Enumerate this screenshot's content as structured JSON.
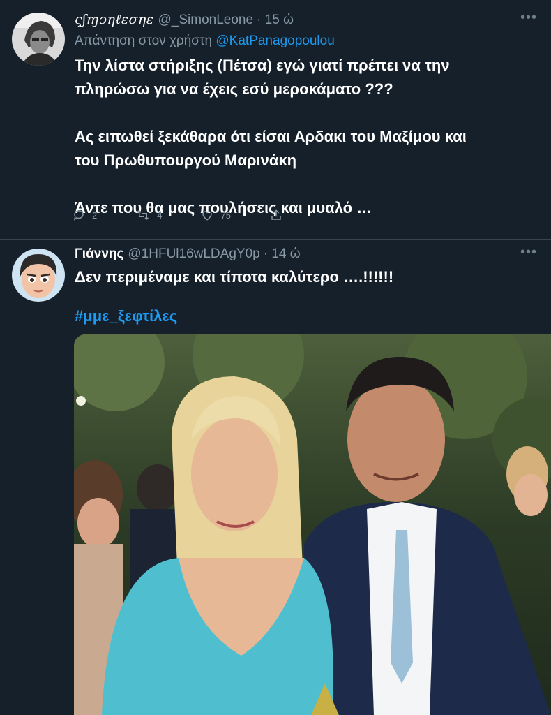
{
  "tweet1": {
    "display_name": "ςʃɱɔηℓεσηε",
    "handle": "@_SimonLeone",
    "time": "· 15 ώ",
    "reply_prefix": "Απάντηση στον χρήστη",
    "reply_mention": "@KatPanagopoulou",
    "lines": [
      "Την λίστα στήριξης (Πέτσα) εγώ γιατί πρέπει να την",
      "πληρώσω για να έχεις εσύ μεροκάματο ???",
      "Ας ειπωθεί ξεκάθαρα ότι είσαι Αρδακι του Μαξίμου και",
      "του Πρωθυπουργού Μαρινάκη",
      "Άντε που θα μας πουλήσεις και μυαλό …"
    ],
    "replies": "2",
    "retweets": "4",
    "likes": "75"
  },
  "tweet2": {
    "display_name": "Γιάννης",
    "handle": "@1HFUl16wLDAgY0p",
    "time": "· 14 ώ",
    "text": "Δεν περιμέναμε και τίποτα καλύτερο ….!!!!!!",
    "hashtag": "#μμε_ξεφτίλες"
  },
  "icons": {
    "reply": "reply-icon",
    "retweet": "retweet-icon",
    "like": "heart-icon",
    "share": "share-icon",
    "more": "more-icon"
  },
  "colors": {
    "background": "#15202b",
    "link": "#1d9bf0",
    "muted": "#8899a6"
  }
}
